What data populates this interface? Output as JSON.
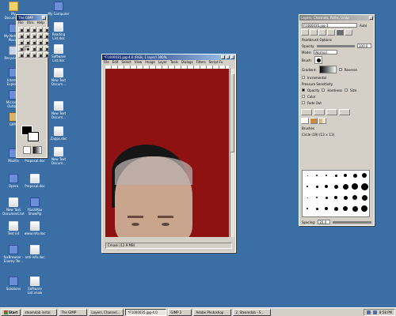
{
  "desktop_icons": [
    {
      "label": "My Documents",
      "icon": "folder"
    },
    {
      "label": "My Network Places",
      "icon": "app"
    },
    {
      "label": "Recycle Bin",
      "icon": "recycle"
    },
    {
      "label": "Internet Explorer",
      "icon": "app"
    },
    {
      "label": "Microsoft Outlook",
      "icon": "app"
    },
    {
      "label": "GIMP",
      "icon": "gimp"
    },
    {
      "label": "Mozilla",
      "icon": "app"
    },
    {
      "label": "Opera",
      "icon": "app"
    },
    {
      "label": "New Text Document.txt",
      "icon": "doc"
    },
    {
      "label": "Text Ed",
      "icon": "doc"
    },
    {
      "label": "foxBrowser - Enemy Ter...",
      "icon": "app"
    },
    {
      "label": "Solutions",
      "icon": "app"
    },
    {
      "label": "My Computer",
      "icon": "app"
    },
    {
      "label": "Reading List.doc",
      "icon": "doc"
    },
    {
      "label": "Software List.doc",
      "icon": "doc"
    },
    {
      "label": "New Text Docum...",
      "icon": "doc"
    },
    {
      "label": "New Text Docum...",
      "icon": "doc"
    },
    {
      "label": "Zapps.doc",
      "icon": "doc"
    },
    {
      "label": "New Text Docum...",
      "icon": "doc"
    },
    {
      "label": "Proposal.doc",
      "icon": "doc"
    },
    {
      "label": "Proposal.doc",
      "icon": "doc"
    },
    {
      "label": "FlashMax ShowPip",
      "icon": "app"
    },
    {
      "label": "www.info.doc",
      "icon": "doc"
    },
    {
      "label": "anti-info.doc",
      "icon": "doc"
    },
    {
      "label": "Software List.snow",
      "icon": "doc"
    }
  ],
  "toolbox": {
    "title": "The GIMP",
    "menu": [
      "File",
      "Xtns",
      "Help"
    ]
  },
  "image_window": {
    "title": "*F1000035.jpg-4.0 (RGB, 1 layer) 300%",
    "menu": [
      "File",
      "Edit",
      "Select",
      "View",
      "Image",
      "Layer",
      "Tools",
      "Dialogs",
      "Filters",
      "Script-Fu"
    ],
    "status": "Cmask (12.9 MB)"
  },
  "layers_dialog": {
    "title": "Layers, Channels, Paths, Undo",
    "image_select": "F1000035.jpg-1",
    "auto_label": "Auto",
    "section_title": "Paintbrush Options",
    "opacity_label": "Opacity:",
    "opacity_value": "100.0",
    "mode_label": "Mode:",
    "mode_value": "Normal",
    "brush_label": "Brush:",
    "gradient_label": "Gradient:",
    "reverse_label": "Reverse",
    "incremental_label": "Incremental",
    "pressure_label": "Pressure Sensitivity",
    "pressure_opacity": "Opacity",
    "pressure_hardness": "Hardness",
    "pressure_size": "Size",
    "color_label": "Color",
    "fade_label": "Fade Out",
    "brushes_title": "Brushes",
    "brush_name": "Circle (19) (13 × 13)",
    "spacing_label": "Spacing:",
    "spacing_value": "20.0"
  },
  "taskbar": {
    "start_label": "Start",
    "tasks": [
      "steamdab instal",
      "The GIMP",
      "Layers, Channel...",
      "*F1000035.jpg-4.0",
      "GIMP 2",
      "Adobe Photoshop",
      "2. Steamdab - S..."
    ],
    "active_task_index": 3,
    "clock": "8:58 PM"
  }
}
